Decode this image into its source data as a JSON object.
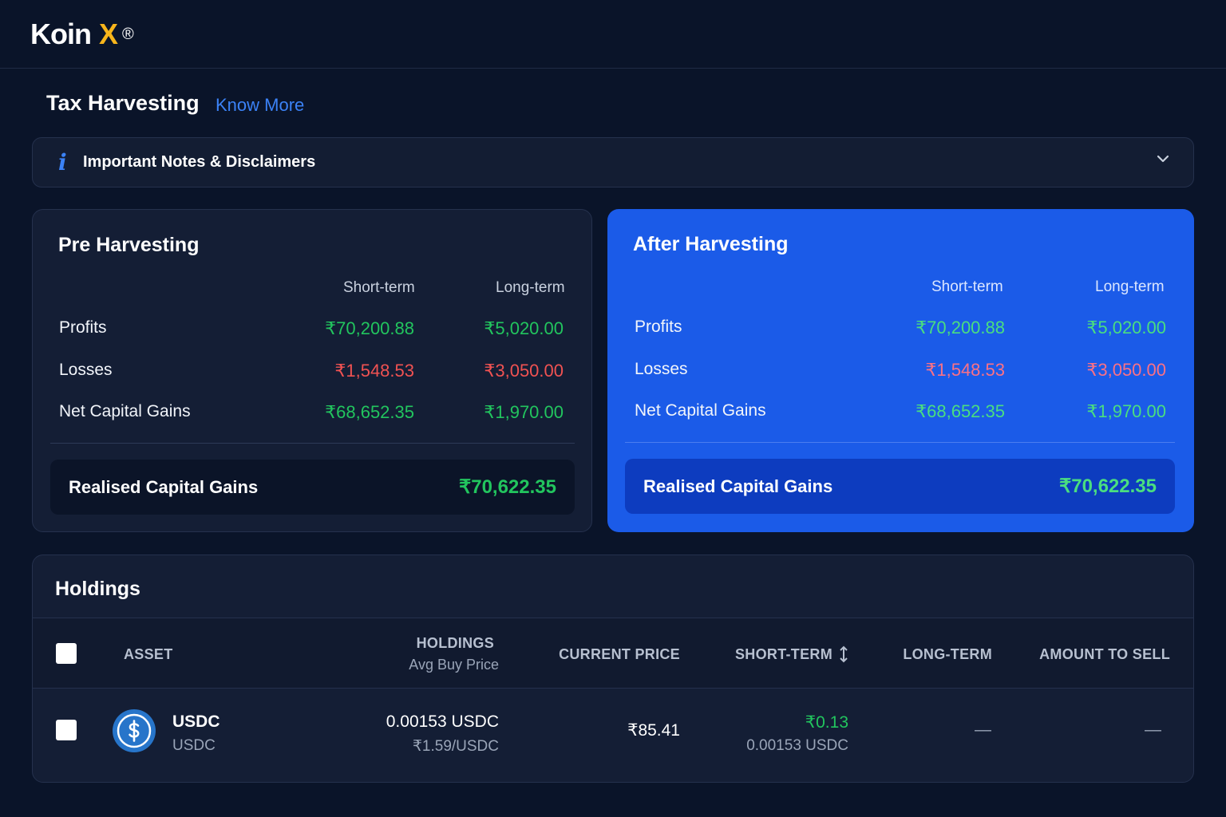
{
  "brand": {
    "name": "Koin",
    "x": "X",
    "reg": "®"
  },
  "page": {
    "title": "Tax Harvesting",
    "know_more": "Know More"
  },
  "notes": {
    "label": "Important Notes & Disclaimers",
    "info_glyph": "i"
  },
  "pre": {
    "title": "Pre Harvesting",
    "col_short": "Short-term",
    "col_long": "Long-term",
    "rows": [
      {
        "label": "Profits",
        "short": "₹70,200.88",
        "long": "₹5,020.00"
      },
      {
        "label": "Losses",
        "short": "₹1,548.53",
        "long": "₹3,050.00"
      },
      {
        "label": "Net Capital Gains",
        "short": "₹68,652.35",
        "long": "₹1,970.00"
      }
    ],
    "realised_label": "Realised Capital Gains",
    "realised_value": "₹70,622.35"
  },
  "after": {
    "title": "After Harvesting",
    "col_short": "Short-term",
    "col_long": "Long-term",
    "rows": [
      {
        "label": "Profits",
        "short": "₹70,200.88",
        "long": "₹5,020.00"
      },
      {
        "label": "Losses",
        "short": "₹1,548.53",
        "long": "₹3,050.00"
      },
      {
        "label": "Net Capital Gains",
        "short": "₹68,652.35",
        "long": "₹1,970.00"
      }
    ],
    "realised_label": "Realised Capital Gains",
    "realised_value": "₹70,622.35"
  },
  "holdings": {
    "title": "Holdings",
    "headers": {
      "asset": "ASSET",
      "holdings": "HOLDINGS",
      "holdings_sub": "Avg Buy Price",
      "current_price": "CURRENT PRICE",
      "short_term": "SHORT-TERM",
      "long_term": "LONG-TERM",
      "amount_to_sell": "AMOUNT TO SELL"
    },
    "rows": [
      {
        "name": "USDC",
        "symbol": "USDC",
        "holdings": "0.00153 USDC",
        "avg_buy_price": "₹1.59/USDC",
        "current_price": "₹85.41",
        "short_term_gain": "₹0.13",
        "short_term_qty": "0.00153 USDC",
        "long_term": "—",
        "amount_to_sell": "—"
      }
    ]
  },
  "colors": {
    "background": "#0a1429",
    "accent_blue": "#1b5be8",
    "gain_green": "#22c55e",
    "loss_red": "#f05252",
    "brand_yellow": "#f7b51b"
  },
  "icons": [
    "info-icon",
    "chevron-down-icon",
    "sort-icon",
    "usdc-coin-icon"
  ]
}
